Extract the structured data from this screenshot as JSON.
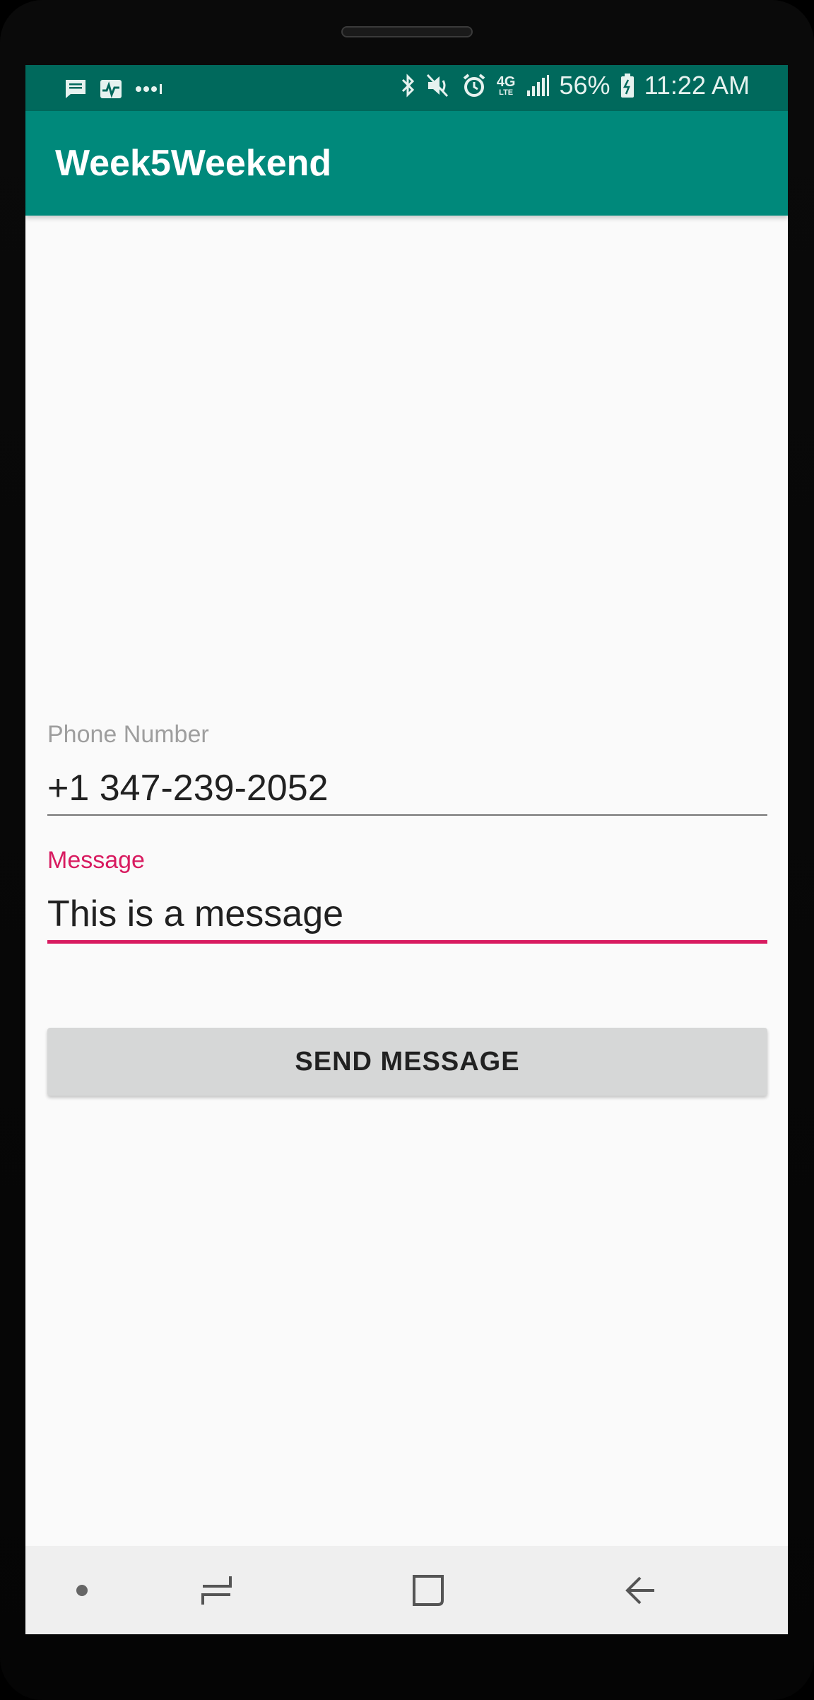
{
  "status_bar": {
    "battery": "56%",
    "time": "11:22 AM",
    "network": "4G",
    "left_icons": [
      "message-icon",
      "activity-icon",
      "more-dots-icon"
    ],
    "right_icons": [
      "bluetooth-icon",
      "mute-icon",
      "alarm-icon",
      "lte-icon",
      "signal-icon",
      "battery-icon"
    ],
    "background": "#00695c"
  },
  "app_bar": {
    "title": "Week5Weekend",
    "background": "#00897b"
  },
  "form": {
    "phone": {
      "label": "Phone Number",
      "value": "+1 347-239-2052"
    },
    "message": {
      "label": "Message",
      "value": "This is a message",
      "focused": true,
      "accent": "#d81b60"
    },
    "send_button": {
      "label": "SEND MESSAGE"
    }
  },
  "nav_bar": {
    "items": [
      "dot-icon",
      "recent-apps-icon",
      "home-icon",
      "back-icon"
    ]
  }
}
